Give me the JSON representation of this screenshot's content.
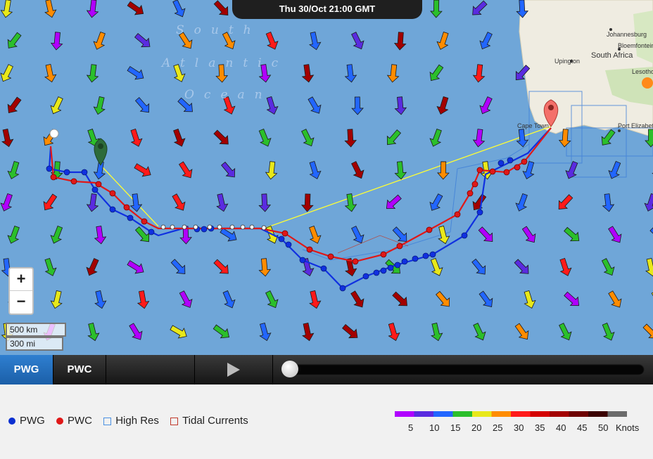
{
  "header": {
    "timestamp": "Thu 30/Oct 21:00 GMT"
  },
  "map": {
    "ocean_labels": [
      "South",
      "Atlantic",
      "Ocean"
    ],
    "place_labels": [
      "Johannesburg",
      "South Africa",
      "Bloemfontein",
      "Lesotho",
      "Upington",
      "Cape Town",
      "Port Elizabeth"
    ]
  },
  "zoom": {
    "in_label": "+",
    "out_label": "−"
  },
  "scale": {
    "km": "500 km",
    "mi": "300 mi"
  },
  "controls": {
    "tab_pwg": "PWG",
    "tab_pwc": "PWC",
    "play_icon": "play-icon"
  },
  "legend": {
    "items": [
      {
        "label": "PWG",
        "color": "#0b2fd1"
      },
      {
        "label": "PWC",
        "color": "#e01818"
      },
      {
        "label": "High Res",
        "color": "#4a90e2"
      },
      {
        "label": "Tidal Currents",
        "color": "#c0392b"
      }
    ]
  },
  "wind_scale": {
    "ticks": [
      "5",
      "10",
      "15",
      "20",
      "25",
      "30",
      "35",
      "40",
      "45",
      "50"
    ],
    "unit": "Knots",
    "colors": [
      "#b000ff",
      "#5a2be0",
      "#2266ff",
      "#2bbf2b",
      "#e8e81a",
      "#ff8c00",
      "#ff1a1a",
      "#d40000",
      "#a30000",
      "#6e0000",
      "#3b0000",
      "#6b6b6b"
    ]
  }
}
